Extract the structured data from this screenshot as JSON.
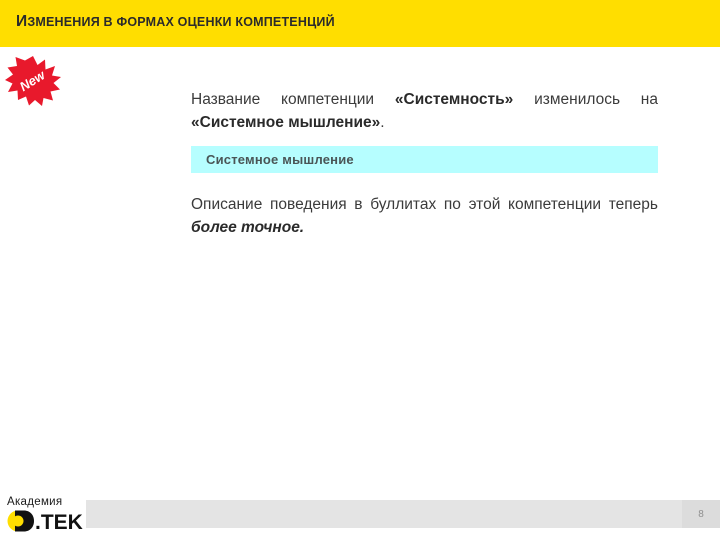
{
  "slide": {
    "title": {
      "first_letter": "И",
      "rest": "зменения в формах оценки компетенций",
      "full": "ИЗМЕНЕНИЯ В ФОРМАХ ОЦЕНКИ КОМПЕТЕНЦИЙ"
    },
    "badge": {
      "label": "New",
      "icon": "starburst-icon",
      "color": "#e8192c"
    },
    "paragraph_1": {
      "part_1": "Название компетенции ",
      "part_2_bold": "«Системность»",
      "part_3": " изменилось на ",
      "part_4_bold": "«Системное мышление»",
      "part_5": "."
    },
    "competency_box": {
      "label": "Системное мышление",
      "background": "#b6feff",
      "text_color": "#4a5556"
    },
    "paragraph_2": {
      "part_1": "Описание поведения в буллитах по этой компетенции теперь ",
      "part_2_bold_italic": "более точное."
    },
    "footer": {
      "logo_top": "Академия",
      "logo_bottom": "ДТЕК",
      "logo_dot_text": ".TEK",
      "page_number": "8",
      "bar_color": "#e4e4e4",
      "accent_color": "#ffde00"
    }
  }
}
